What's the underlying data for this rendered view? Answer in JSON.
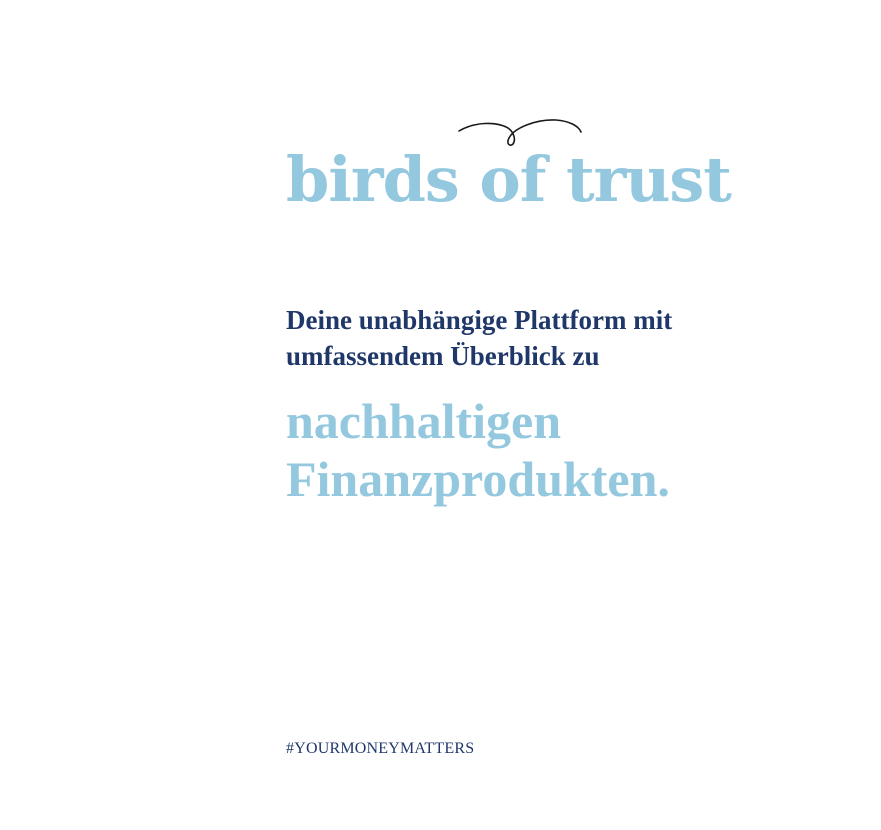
{
  "logo": {
    "text": "birds of trust",
    "icon": "bird-swirl-icon"
  },
  "tagline": {
    "text": "Deine unabhängige Plattform mit umfassendem Überblick zu"
  },
  "highlight": {
    "line1": "nachhaltigen",
    "line2": "Finanzprodukten."
  },
  "hashtag": {
    "text": "#YOURMONEYMATTERS"
  },
  "colors": {
    "background": "#ffffff",
    "accent_light_blue": "#93c8de",
    "navy": "#1f3769",
    "swirl": "#1a1a1a"
  }
}
